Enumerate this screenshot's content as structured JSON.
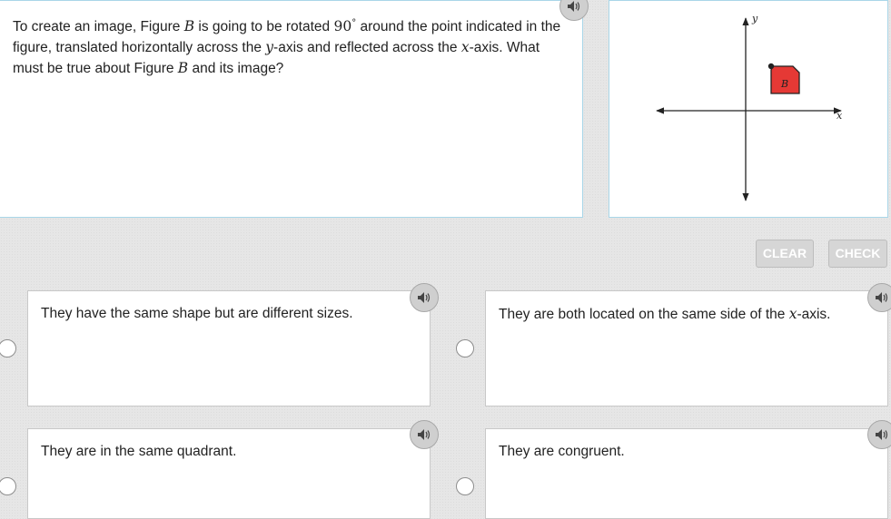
{
  "question": {
    "part1": "To create an image, Figure ",
    "fig1": "B",
    "part2": " is going to be rotated ",
    "angle": "90",
    "degree": "°",
    "part3": " around the point indicated in the figure, translated horizontally across the ",
    "y_var": "y",
    "part4": "-axis and reflected across the ",
    "x_var": "x",
    "part5": "-axis. What must be true about Figure ",
    "fig2": "B",
    "part6": " and its image?"
  },
  "graph": {
    "x_label": "x",
    "y_label": "y",
    "figure_label": "B",
    "figure_fill": "#e53935"
  },
  "buttons": {
    "clear": "CLEAR",
    "check": "CHECK"
  },
  "choices": [
    {
      "text": "They have the same shape but are different sizes."
    },
    {
      "pre": "They are both located on the same side of the ",
      "var": "x",
      "post": "-axis."
    },
    {
      "text": "They are in the same quadrant."
    },
    {
      "text": "They are congruent."
    }
  ],
  "icons": {
    "audio": "speaker-icon"
  }
}
